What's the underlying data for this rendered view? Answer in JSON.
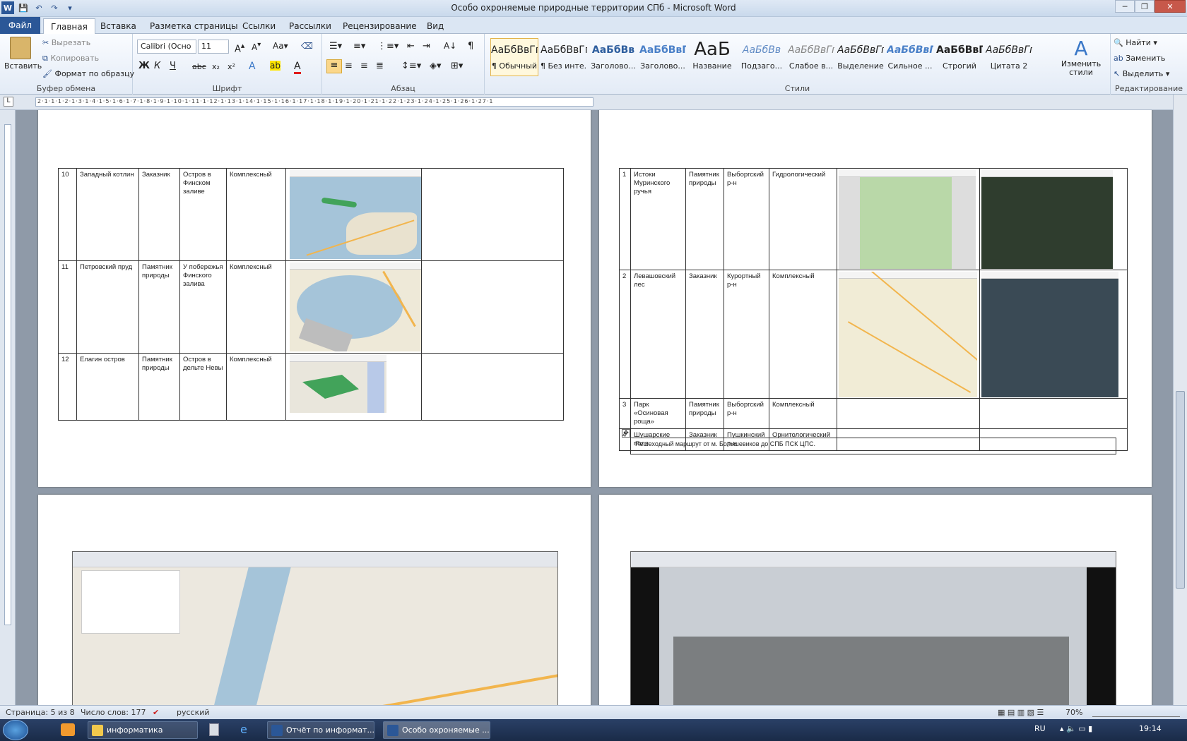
{
  "window": {
    "title": "Особо охроняемые природные территории СПб  -  Microsoft Word"
  },
  "qat": {
    "save": "💾",
    "undo": "↶",
    "redo": "↷",
    "more": "▾"
  },
  "ribbon_tabs": [
    "Файл",
    "Главная",
    "Вставка",
    "Разметка страницы",
    "Ссылки",
    "Рассылки",
    "Рецензирование",
    "Вид"
  ],
  "clipboard": {
    "paste": "Вставить",
    "cut": "Вырезать",
    "copy": "Копировать",
    "format_painter": "Формат по образцу",
    "label": "Буфер обмена"
  },
  "font": {
    "name": "Calibri (Осно",
    "size": "11",
    "label": "Шрифт"
  },
  "paragraph": {
    "label": "Абзац"
  },
  "styles": {
    "items": [
      {
        "preview": "АаБбВвГг,",
        "name": "¶ Обычный"
      },
      {
        "preview": "АаБбВвГг,",
        "name": "¶ Без инте..."
      },
      {
        "preview": "АаБбВв",
        "name": "Заголово..."
      },
      {
        "preview": "АаБбВвГ",
        "name": "Заголово..."
      },
      {
        "preview": "АаБ",
        "name": "Название"
      },
      {
        "preview": "АаБбВв",
        "name": "Подзаго..."
      },
      {
        "preview": "АаБбВвГг",
        "name": "Слабое в..."
      },
      {
        "preview": "АаБбВвГг",
        "name": "Выделение"
      },
      {
        "preview": "АаБбВвГг",
        "name": "Сильное ..."
      },
      {
        "preview": "АаБбВвГг,",
        "name": "Строгий"
      },
      {
        "preview": "АаБбВвГг",
        "name": "Цитата 2"
      }
    ],
    "change": "Изменить стили",
    "label": "Стили"
  },
  "editing": {
    "find": "Найти",
    "replace": "Заменить",
    "select": "Выделить",
    "label": "Редактирование"
  },
  "ruler_text": "2·1·1·1·2·1·3·1·4·1·5·1·6·1·7·1·8·1·9·1·10·1·11·1·12·1·13·1·14·1·15·1·16·1·17·1·18·1·19·1·20·1·21·1·22·1·23·1·24·1·25·1·26·1·27·1",
  "left_table": [
    {
      "num": "10",
      "name": "Западный котлин",
      "type": "Заказник",
      "location": "Остров в Финском заливе",
      "profile": "Комплексный"
    },
    {
      "num": "11",
      "name": "Петровский пруд",
      "type": "Памятник природы",
      "location": "У побережья Финского залива",
      "profile": "Комплексный"
    },
    {
      "num": "12",
      "name": "Елагин остров",
      "type": "Памятник природы",
      "location": "Остров в дельте Невы",
      "profile": "Комплексный"
    }
  ],
  "right_table": [
    {
      "num": "1",
      "name": "Истоки Муринского ручья",
      "type": "Памятник природы",
      "location": "Выборгский р-н",
      "profile": "Гидрологический"
    },
    {
      "num": "2",
      "name": "Левашовский лес",
      "type": "Заказник",
      "location": "Курортный р-н",
      "profile": "Комплексный"
    },
    {
      "num": "3",
      "name": "Парк «Осиновая роща»",
      "type": "Памятник природы",
      "location": "Выборгский р-н",
      "profile": "Комплексный"
    },
    {
      "num": "4",
      "name": "Шушарские поля",
      "type": "Заказник",
      "location": "Пушкинский р-н",
      "profile": "Орнитологический"
    }
  ],
  "route_caption": "Пешеходный  маршрут от м. Большевиков  до СПБ ПСК ЦПС.",
  "status": {
    "page": "Страница: 5 из 8",
    "words": "Число слов: 177",
    "lang": "русский",
    "zoom": "70%"
  },
  "taskbar": {
    "items": [
      "информатика",
      "Отчёт по информат...",
      "Особо охроняемые ..."
    ],
    "lang": "RU",
    "clock": "19:14"
  }
}
